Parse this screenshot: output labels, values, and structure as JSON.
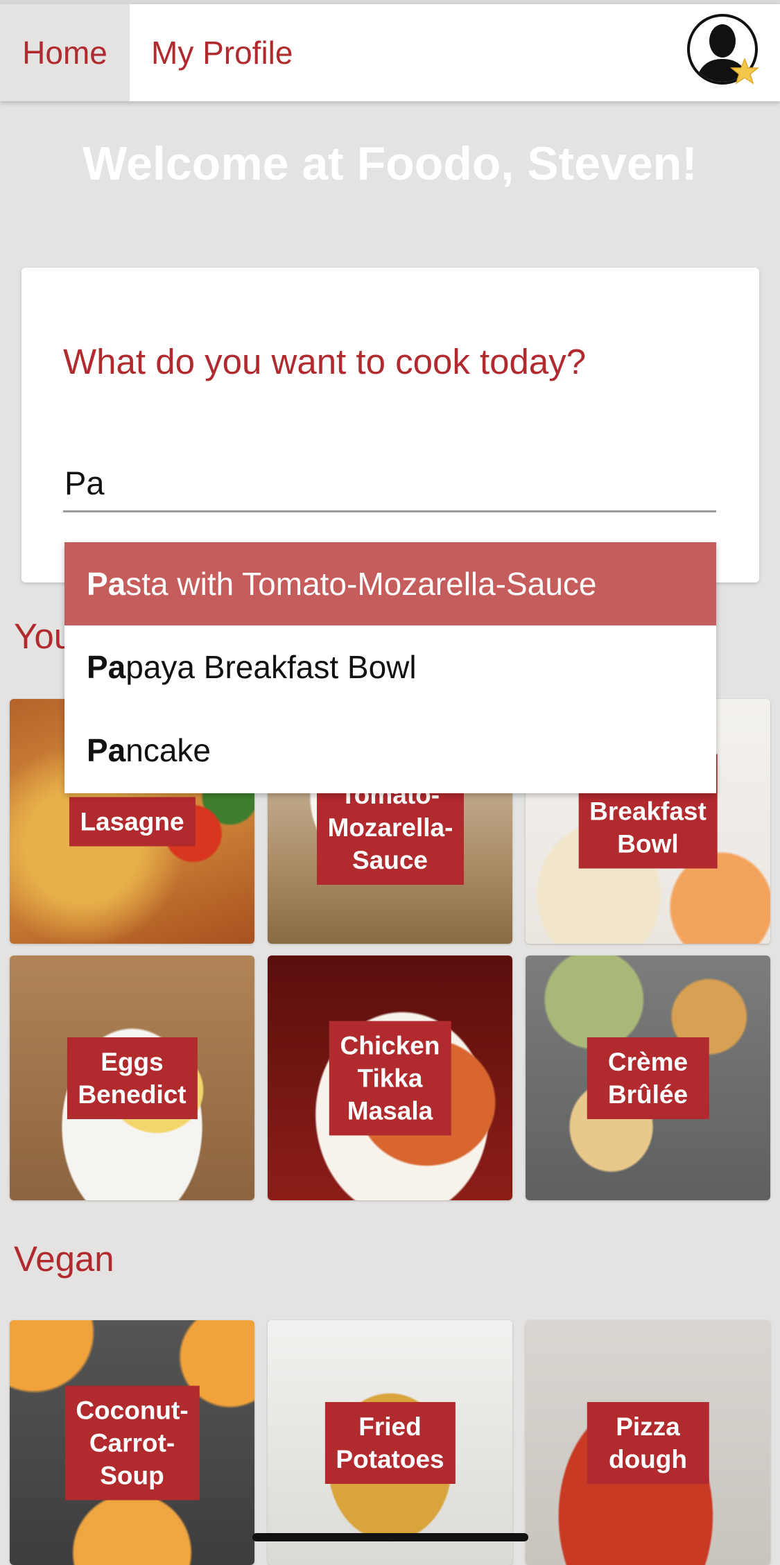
{
  "nav": {
    "home_label": "Home",
    "profile_label": "My Profile",
    "avatar_icon": "user-avatar-star-icon",
    "accent_color": "#b02a2e"
  },
  "welcome": "Welcome at Foodo, Steven!",
  "search": {
    "title": "What do you want to cook today?",
    "value": "Pa",
    "placeholder": ""
  },
  "autocomplete": {
    "items": [
      {
        "match": "Pa",
        "rest": "sta with Tomato-Mozarella-Sauce"
      },
      {
        "match": "Pa",
        "rest": "paya Breakfast Bowl"
      },
      {
        "match": "Pa",
        "rest": "ncake"
      }
    ],
    "highlight_color": "#c65d5d"
  },
  "sections": {
    "first": {
      "title_visible": "You",
      "tiles": [
        {
          "label": "Lasagne"
        },
        {
          "label": "with Tomato-Mozarella-Sauce"
        },
        {
          "label": "Papaya Breakfast Bowl"
        },
        {
          "label": "Eggs Benedict"
        },
        {
          "label": "Chicken Tikka Masala"
        },
        {
          "label": "Crème Brûlée"
        }
      ]
    },
    "vegan": {
      "title": "Vegan",
      "tiles": [
        {
          "label": "Coconut-Carrot-Soup"
        },
        {
          "label": "Fried Potatoes"
        },
        {
          "label": "Pizza dough"
        }
      ]
    }
  }
}
